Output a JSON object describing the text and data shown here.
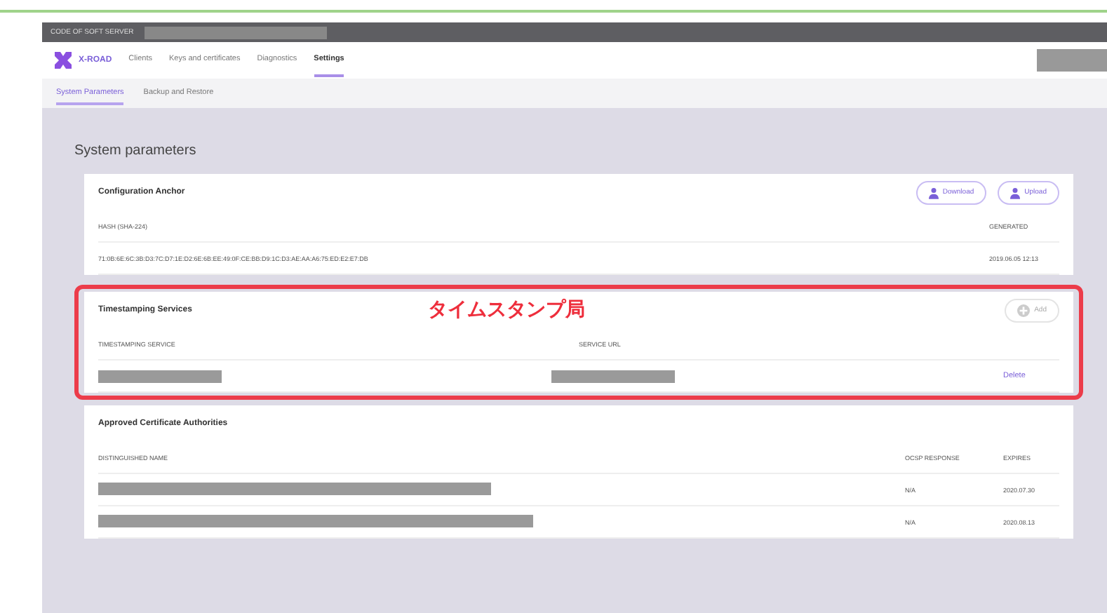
{
  "header": {
    "server_label": "CODE OF SOFT SERVER"
  },
  "nav": {
    "logo": "X-ROAD",
    "items": [
      {
        "label": "Clients",
        "selected": false
      },
      {
        "label": "Keys and certificates",
        "selected": false
      },
      {
        "label": "Diagnostics",
        "selected": false
      },
      {
        "label": "Settings",
        "selected": true
      }
    ]
  },
  "subtabs": [
    {
      "label": "System Parameters",
      "selected": true
    },
    {
      "label": "Backup and Restore",
      "selected": false
    }
  ],
  "page_title": "System parameters",
  "anchor": {
    "title": "Configuration Anchor",
    "buttons": [
      "Download",
      "Upload"
    ],
    "columns": [
      "HASH (SHA-224)",
      "GENERATED"
    ],
    "row": [
      "71:0B:6E:6C:3B:D3:7C:D7:1E:D2:6E:6B:EE:49:0F:CE:BB:D9:1C:D3:AE:AA:A6:75:ED:E2:E7:DB",
      "2019.06.05 12:13"
    ]
  },
  "timestamping": {
    "title": "Timestamping Services",
    "add_button": "Add",
    "annotation": "タイムスタンプ局",
    "columns": [
      "TIMESTAMPING SERVICE",
      "SERVICE URL"
    ],
    "row_action": "Delete"
  },
  "authorities": {
    "title": "Approved Certificate Authorities",
    "columns": [
      "DISTINGUISHED NAME",
      "OCSP RESPONSE",
      "EXPIRES"
    ],
    "rows": [
      {
        "ocsp": "N/A",
        "expires": "2020.07.30"
      },
      {
        "ocsp": "N/A",
        "expires": "2020.08.13"
      }
    ]
  }
}
